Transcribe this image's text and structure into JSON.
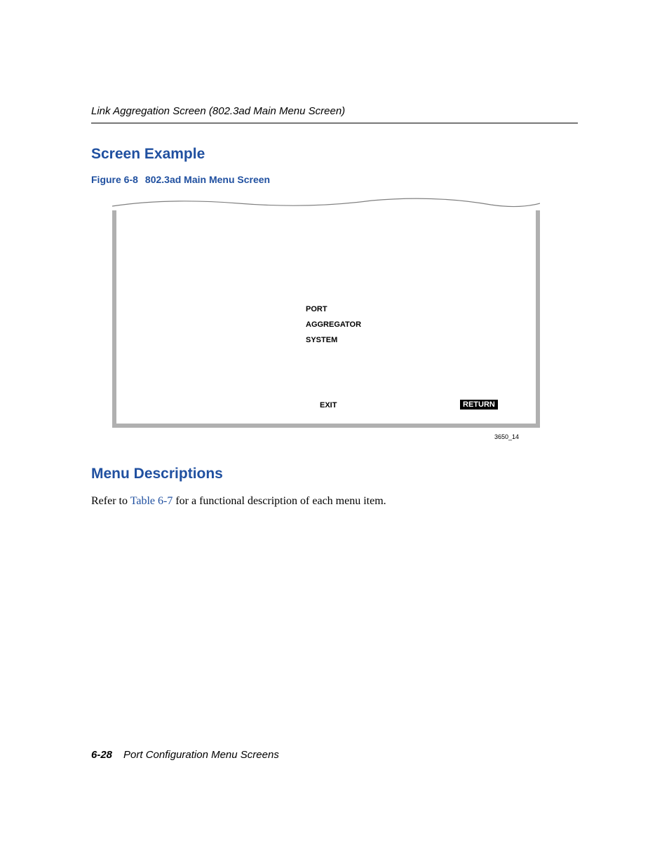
{
  "header": "Link Aggregation Screen (802.3ad Main Menu Screen)",
  "section1": {
    "heading": "Screen Example",
    "figure_label": "Figure 6-8",
    "figure_title": "802.3ad Main Menu Screen"
  },
  "figure": {
    "menu": {
      "item1": "PORT",
      "item2": "AGGREGATOR",
      "item3": "SYSTEM"
    },
    "exit": "EXIT",
    "return": "RETURN",
    "id": "3650_14"
  },
  "section2": {
    "heading": "Menu Descriptions",
    "text_before": "Refer to ",
    "link": "Table 6-7",
    "text_after": " for a functional description of each menu item."
  },
  "footer": {
    "pagenum": "6-28",
    "title": "Port Configuration Menu Screens"
  }
}
